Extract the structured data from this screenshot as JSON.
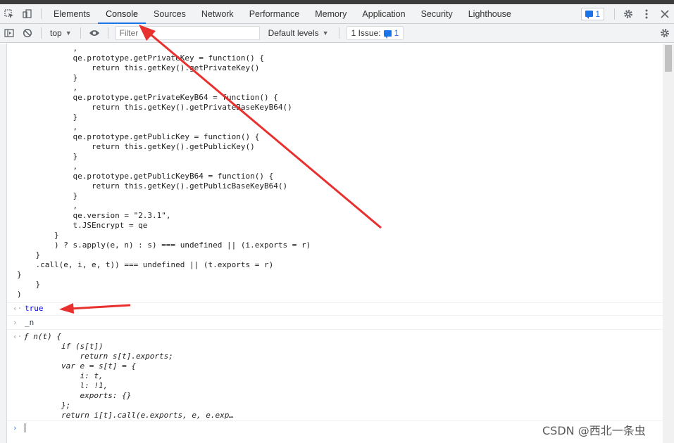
{
  "tabs": [
    {
      "label": "Elements",
      "active": false
    },
    {
      "label": "Console",
      "active": true
    },
    {
      "label": "Sources",
      "active": false
    },
    {
      "label": "Network",
      "active": false
    },
    {
      "label": "Performance",
      "active": false
    },
    {
      "label": "Memory",
      "active": false
    },
    {
      "label": "Application",
      "active": false
    },
    {
      "label": "Security",
      "active": false
    },
    {
      "label": "Lighthouse",
      "active": false
    }
  ],
  "issues_badge": "1",
  "toolbar": {
    "context": "top",
    "filter_placeholder": "Filter",
    "levels": "Default levels",
    "issues_label": "1 Issue:",
    "issues_count": "1"
  },
  "code_lines": [
    "            ,",
    "            qe.prototype.getPrivateKey = function() {",
    "                return this.getKey().getPrivateKey()",
    "            }",
    "            ,",
    "            qe.prototype.getPrivateKeyB64 = function() {",
    "                return this.getKey().getPrivateBaseKeyB64()",
    "            }",
    "            ,",
    "            qe.prototype.getPublicKey = function() {",
    "                return this.getKey().getPublicKey()",
    "            }",
    "            ,",
    "            qe.prototype.getPublicKeyB64 = function() {",
    "                return this.getKey().getPublicBaseKeyB64()",
    "            }",
    "            ,",
    "            qe.version = \"2.3.1\",",
    "            t.JSEncrypt = qe",
    "        }",
    "        ) ? s.apply(e, n) : s) === undefined || (i.exports = r)",
    "    }",
    "    .call(e, i, e, t)) === undefined || (t.exports = r)",
    "}",
    "    }",
    ")"
  ],
  "result_true": "true",
  "input_command": "_n",
  "fn_lines": [
    "ƒ n(t) {",
    "        if (s[t])",
    "            return s[t].exports;",
    "        var e = s[t] = {",
    "            i: t,",
    "            l: !1,",
    "            exports: {}",
    "        };",
    "        return i[t].call(e.exports, e, e.exp…"
  ],
  "watermark": "CSDN @西北一条虫",
  "colors": {
    "accent": "#1a73e8",
    "annotation_arrow": "#e8312f"
  }
}
